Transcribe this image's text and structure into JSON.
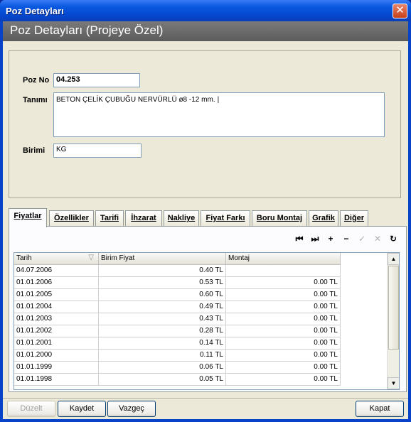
{
  "window": {
    "title": "Poz Detayları"
  },
  "header": {
    "title": "Poz Detayları (Projeye Özel)"
  },
  "form": {
    "poz_no_label": "Poz No",
    "poz_no_value": "04.253",
    "tanimi_label": "Tanımı",
    "tanimi_value": "BETON ÇELİK ÇUBUĞU NERVÜRLÜ ø8 -12 mm.",
    "birimi_label": "Birimi",
    "birimi_value": "KG"
  },
  "tabs": [
    {
      "label": "Fiyatlar"
    },
    {
      "label": "Özellikler"
    },
    {
      "label": "Tarifi"
    },
    {
      "label": "İhzarat"
    },
    {
      "label": "Nakliye"
    },
    {
      "label": "Fiyat Farkı"
    },
    {
      "label": "Boru Montaj"
    },
    {
      "label": "Grafik"
    },
    {
      "label": "Diğer"
    }
  ],
  "nav_icons": [
    "first-record-icon",
    "last-record-icon",
    "add-record-icon",
    "delete-record-icon",
    "confirm-icon",
    "cancel-icon",
    "refresh-icon"
  ],
  "table": {
    "headers": [
      "Tarih",
      "Birim Fiyat",
      "Montaj"
    ],
    "rows": [
      [
        "04.07.2006",
        "0.40 TL",
        ""
      ],
      [
        "01.01.2006",
        "0.53 TL",
        "0.00 TL"
      ],
      [
        "01.01.2005",
        "0.60 TL",
        "0.00 TL"
      ],
      [
        "01.01.2004",
        "0.49 TL",
        "0.00 TL"
      ],
      [
        "01.01.2003",
        "0.43 TL",
        "0.00 TL"
      ],
      [
        "01.01.2002",
        "0.28 TL",
        "0.00 TL"
      ],
      [
        "01.01.2001",
        "0.14 TL",
        "0.00 TL"
      ],
      [
        "01.01.2000",
        "0.11 TL",
        "0.00 TL"
      ],
      [
        "01.01.1999",
        "0.06 TL",
        "0.00 TL"
      ],
      [
        "01.01.1998",
        "0.05 TL",
        "0.00 TL"
      ]
    ]
  },
  "buttons": {
    "duzelt": "Düzelt",
    "kaydet": "Kaydet",
    "vazgec": "Vazgeç",
    "kapat": "Kapat"
  }
}
